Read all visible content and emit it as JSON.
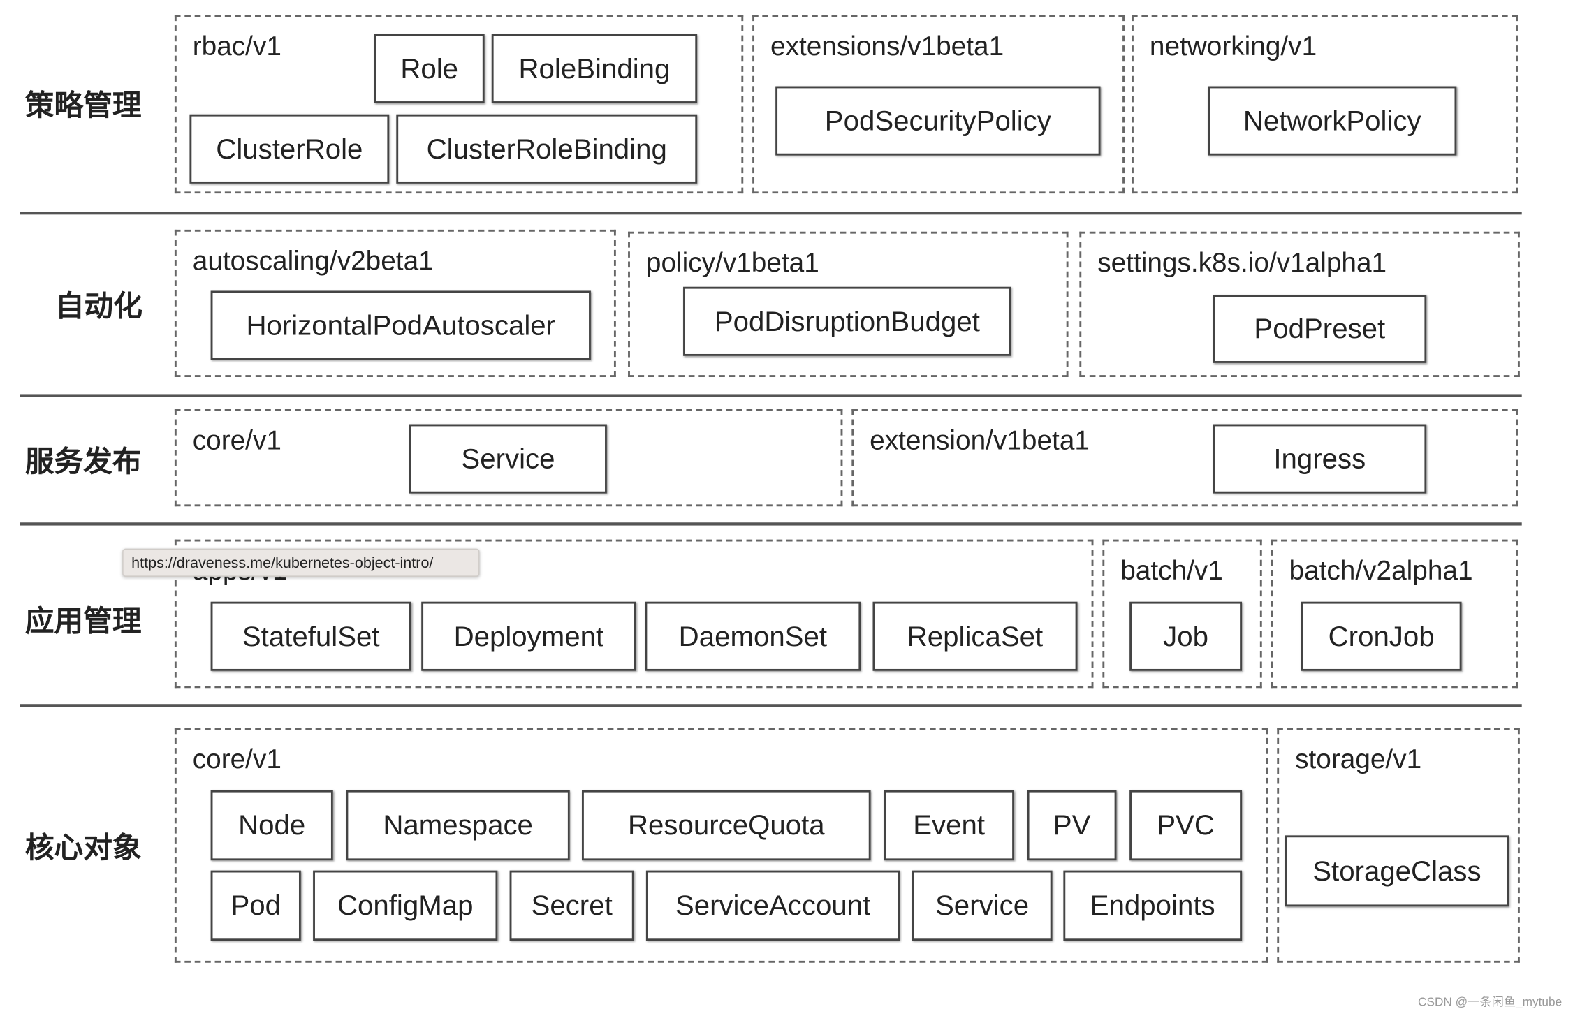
{
  "rows": [
    {
      "category": "策略管理",
      "groups": [
        {
          "label": "rbac/v1",
          "objects": [
            "Role",
            "RoleBinding",
            "ClusterRole",
            "ClusterRoleBinding"
          ]
        },
        {
          "label": "extensions/v1beta1",
          "objects": [
            "PodSecurityPolicy"
          ]
        },
        {
          "label": "networking/v1",
          "objects": [
            "NetworkPolicy"
          ]
        }
      ]
    },
    {
      "category": "自动化",
      "groups": [
        {
          "label": "autoscaling/v2beta1",
          "objects": [
            "HorizontalPodAutoscaler"
          ]
        },
        {
          "label": "policy/v1beta1",
          "objects": [
            "PodDisruptionBudget"
          ]
        },
        {
          "label": "settings.k8s.io/v1alpha1",
          "objects": [
            "PodPreset"
          ]
        }
      ]
    },
    {
      "category": "服务发布",
      "groups": [
        {
          "label": "core/v1",
          "objects": [
            "Service"
          ]
        },
        {
          "label": "extension/v1beta1",
          "objects": [
            "Ingress"
          ]
        }
      ]
    },
    {
      "category": "应用管理",
      "groups": [
        {
          "label": "apps/v1",
          "objects": [
            "StatefulSet",
            "Deployment",
            "DaemonSet",
            "ReplicaSet"
          ]
        },
        {
          "label": "batch/v1",
          "objects": [
            "Job"
          ]
        },
        {
          "label": "batch/v2alpha1",
          "objects": [
            "CronJob"
          ]
        }
      ]
    },
    {
      "category": "核心对象",
      "groups": [
        {
          "label": "core/v1",
          "objects": [
            "Node",
            "Namespace",
            "ResourceQuota",
            "Event",
            "PV",
            "PVC",
            "Pod",
            "ConfigMap",
            "Secret",
            "ServiceAccount",
            "Service",
            "Endpoints"
          ]
        },
        {
          "label": "storage/v1",
          "objects": [
            "StorageClass"
          ]
        }
      ]
    }
  ],
  "tooltip": "https://draveness.me/kubernetes-object-intro/",
  "watermark": "CSDN @一条闲鱼_mytube"
}
